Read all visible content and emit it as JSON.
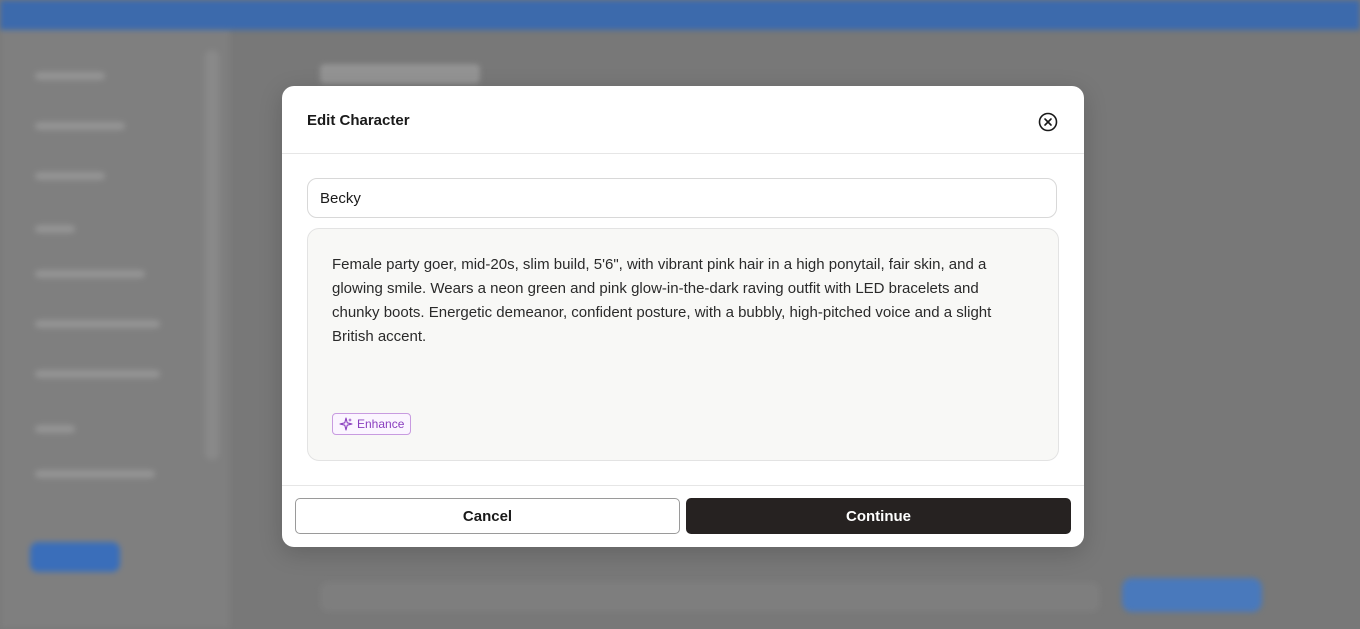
{
  "modal": {
    "title": "Edit Character",
    "name_value": "Becky",
    "description": "Female party goer, mid-20s, slim build, 5'6\", with vibrant pink hair in a high ponytail, fair skin, and a glowing smile. Wears a neon green and pink glow-in-the-dark raving outfit with LED bracelets and chunky boots. Energetic demeanor, confident posture, with a bubbly, high-pitched voice and a slight British accent.",
    "enhance_label": "Enhance",
    "cancel_label": "Cancel",
    "continue_label": "Continue"
  },
  "icons": {
    "close": "close-circle-icon",
    "enhance": "sparkles-icon"
  },
  "colors": {
    "continue_bg": "#262221",
    "enhance_accent": "#8a3fbf",
    "background_brand": "#3f6fb4"
  }
}
